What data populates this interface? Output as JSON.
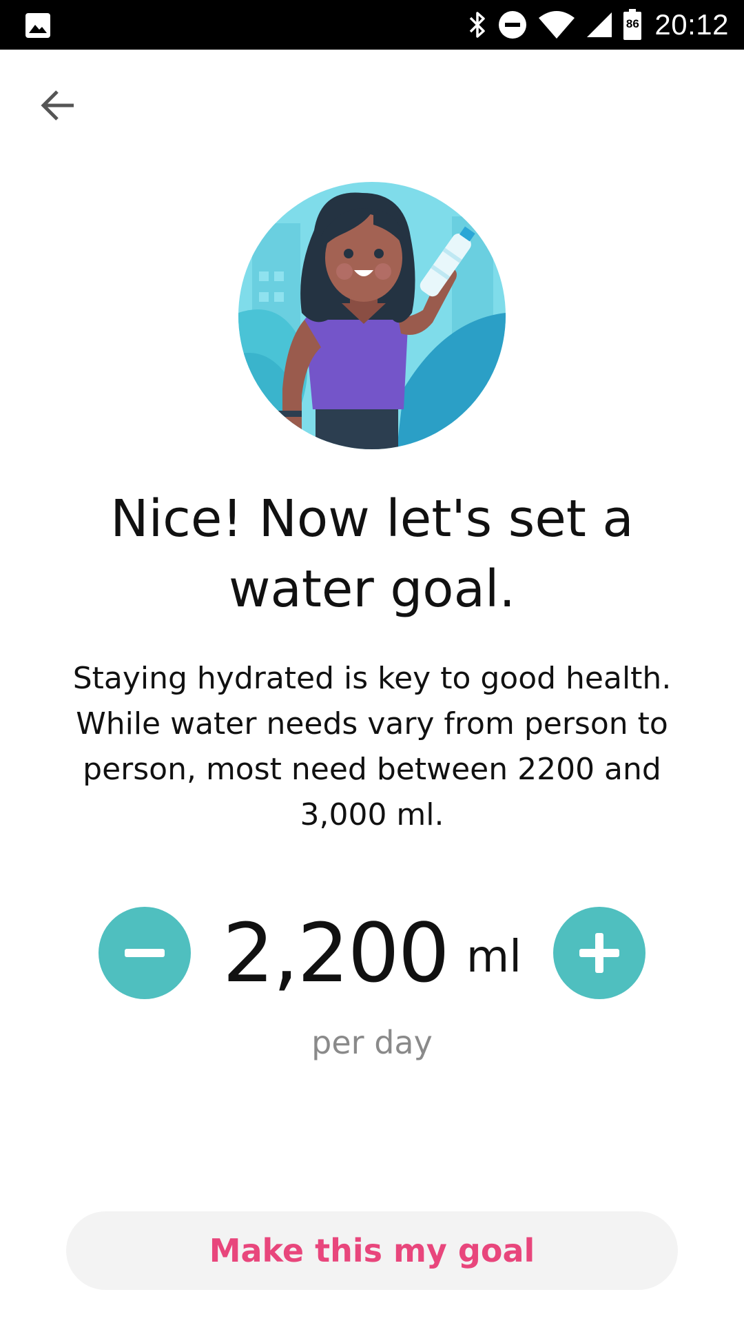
{
  "status_bar": {
    "time": "20:12",
    "battery_level": "86",
    "icons": [
      "image-icon",
      "bluetooth-icon",
      "do-not-disturb-icon",
      "wifi-icon",
      "cell-signal-icon",
      "battery-icon"
    ]
  },
  "nav": {
    "back_icon": "arrow-back-icon"
  },
  "illustration": {
    "icon": "woman-drinking-water-illustration"
  },
  "content": {
    "headline": "Nice! Now let's set a water goal.",
    "description": "Staying hydrated is key to good health. While water needs vary from person to person, most need between 2200 and 3,000 ml."
  },
  "goal": {
    "value": "2,200",
    "unit": "ml",
    "period": "per day",
    "decrease_icon": "minus-icon",
    "increase_icon": "plus-icon"
  },
  "actions": {
    "primary_label": "Make this my goal"
  },
  "colors": {
    "accent": "#4fbfbf",
    "primary_text": "#e8467c",
    "button_bg": "#f3f3f3"
  }
}
